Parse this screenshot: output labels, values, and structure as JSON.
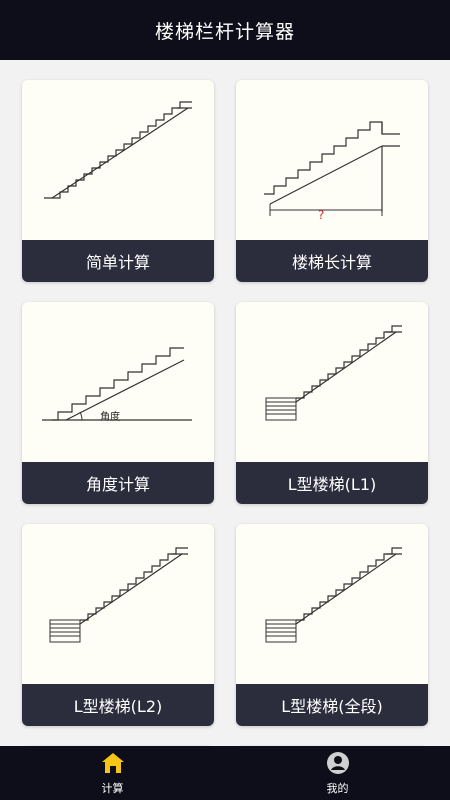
{
  "header": {
    "title": "楼梯栏杆计算器"
  },
  "cards": [
    {
      "label": "简单计算"
    },
    {
      "label": "楼梯长计算",
      "mark": "?"
    },
    {
      "label": "角度计算",
      "mark": "角度"
    },
    {
      "label": "L型楼梯(L1)"
    },
    {
      "label": "L型楼梯(L2)"
    },
    {
      "label": "L型楼梯(全段)"
    }
  ],
  "tabbar": {
    "items": [
      {
        "label": "计算",
        "icon": "home-icon",
        "active": true,
        "color": "#f5c518"
      },
      {
        "label": "我的",
        "icon": "user-icon",
        "active": false
      }
    ]
  },
  "colors": {
    "header_bg": "#0d0e1a",
    "label_bg": "#2b2c3c",
    "card_bg": "#fffef6",
    "accent": "#f5c518",
    "mark_red": "#d32f2f"
  }
}
